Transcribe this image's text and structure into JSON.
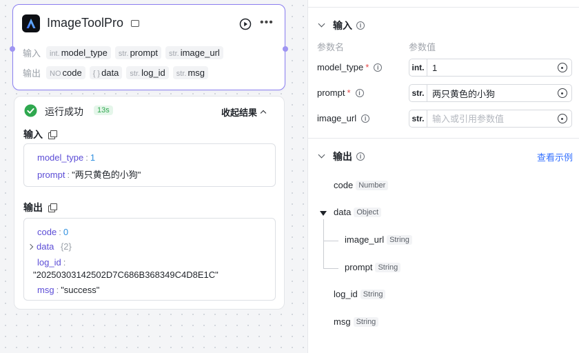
{
  "canvas": {
    "node": {
      "title": "ImageToolPro",
      "inputs_label": "输入",
      "outputs_label": "输出",
      "inputs": [
        {
          "type": "int.",
          "name": "model_type"
        },
        {
          "type": "str.",
          "name": "prompt"
        },
        {
          "type": "str.",
          "name": "image_url"
        }
      ],
      "outputs": [
        {
          "type": "NO",
          "name": "code"
        },
        {
          "type": "{ }",
          "name": "data"
        },
        {
          "type": "str.",
          "name": "log_id"
        },
        {
          "type": "str.",
          "name": "msg"
        }
      ]
    },
    "result": {
      "status": "运行成功",
      "duration": "13s",
      "collapse_label": "收起结果",
      "input_title": "输入",
      "output_title": "输出",
      "input_items": [
        {
          "key": "model_type",
          "value": "1"
        },
        {
          "key": "prompt",
          "value": "\"两只黄色的小狗\""
        }
      ],
      "output_items": {
        "code": {
          "key": "code",
          "value": "0"
        },
        "data": {
          "key": "data",
          "count": "{2}"
        },
        "log_id": {
          "key": "log_id",
          "value": "\"20250303142502D7C686B368349C4D8E1C\""
        },
        "msg": {
          "key": "msg",
          "value": "\"success\""
        }
      }
    }
  },
  "panel": {
    "input_title": "输入",
    "col_name": "参数名",
    "col_value": "参数值",
    "params": [
      {
        "name": "model_type",
        "required": true,
        "type": "int.",
        "value": "1",
        "placeholder": ""
      },
      {
        "name": "prompt",
        "required": true,
        "type": "str.",
        "value": "两只黄色的小狗",
        "placeholder": ""
      },
      {
        "name": "image_url",
        "required": false,
        "type": "str.",
        "value": "",
        "placeholder": "输入或引用参数值"
      }
    ],
    "output_title": "输出",
    "example_link": "查看示例",
    "outputs": {
      "code": {
        "name": "code",
        "type": "Number"
      },
      "data": {
        "name": "data",
        "type": "Object"
      },
      "image_url": {
        "name": "image_url",
        "type": "String"
      },
      "prompt": {
        "name": "prompt",
        "type": "String"
      },
      "log_id": {
        "name": "log_id",
        "type": "String"
      },
      "msg": {
        "name": "msg",
        "type": "String"
      }
    }
  },
  "colors": {
    "accent": "#8b7ff0",
    "success": "#2fa84f",
    "link": "#3370ff",
    "required": "#e54545"
  }
}
